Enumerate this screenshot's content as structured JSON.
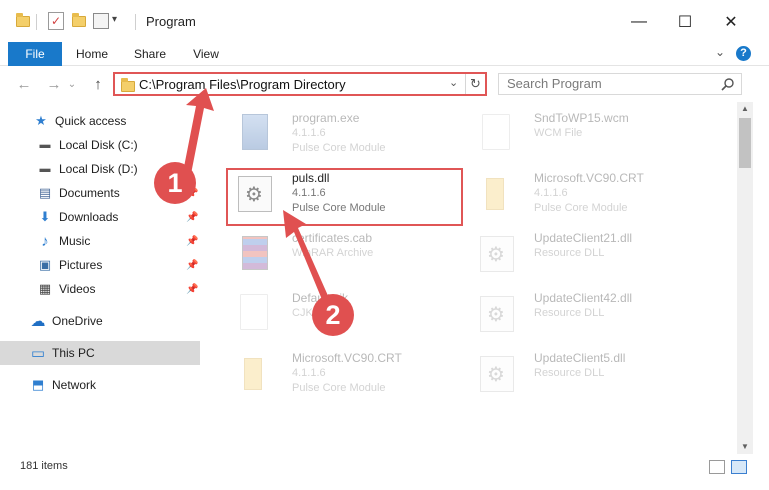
{
  "window": {
    "title": "Program",
    "minimize_glyph": "—",
    "maximize_glyph": "☐",
    "close_glyph": "✕"
  },
  "ribbon": {
    "tabs": [
      {
        "label": "File"
      },
      {
        "label": "Home"
      },
      {
        "label": "Share"
      },
      {
        "label": "View"
      }
    ],
    "help_glyph": "?",
    "collapse_glyph": "⌄"
  },
  "navigation": {
    "back_glyph": "←",
    "forward_glyph": "→",
    "recent_glyph": "⌄",
    "up_glyph": "↑"
  },
  "address": {
    "path": "C:\\Program Files\\Program Directory",
    "dropdown_glyph": "⌄",
    "refresh_glyph": "↻"
  },
  "search": {
    "placeholder": "Search Program"
  },
  "sidebar": {
    "items": [
      {
        "label": "Quick access",
        "icon": "star-icon",
        "glyph": "★",
        "color": "#2f7fd0",
        "pinned": false
      },
      {
        "label": "Local Disk (C:)",
        "icon": "drive-icon",
        "glyph": "▬",
        "color": "#555555",
        "pinned": false
      },
      {
        "label": "Local Disk (D:)",
        "icon": "drive-icon",
        "glyph": "▬",
        "color": "#555555",
        "pinned": false
      },
      {
        "label": "Documents",
        "icon": "documents-icon",
        "glyph": "▤",
        "color": "#4a6b9a",
        "pinned": true
      },
      {
        "label": "Downloads",
        "icon": "download-icon",
        "glyph": "⬇",
        "color": "#2f7fd0",
        "pinned": true
      },
      {
        "label": "Music",
        "icon": "music-icon",
        "glyph": "♪",
        "color": "#2f7fd0",
        "pinned": true
      },
      {
        "label": "Pictures",
        "icon": "pictures-icon",
        "glyph": "▣",
        "color": "#3a6ea5",
        "pinned": true
      },
      {
        "label": "Videos",
        "icon": "video-icon",
        "glyph": "▦",
        "color": "#444444",
        "pinned": true
      },
      {
        "label": "OneDrive",
        "icon": "cloud-icon",
        "glyph": "☁",
        "color": "#1f6fc4",
        "pinned": false
      },
      {
        "label": "This PC",
        "icon": "computer-icon",
        "glyph": "▭",
        "color": "#2f7fd0",
        "pinned": false,
        "selected": true
      },
      {
        "label": "Network",
        "icon": "network-icon",
        "glyph": "⬒",
        "color": "#2f7fd0",
        "pinned": false
      }
    ],
    "pin_glyph": "📌"
  },
  "files": [
    {
      "name": "program.exe",
      "line1": "4.1.1.6",
      "line2": "Pulse Core Module",
      "thumb": "exe",
      "faded": true
    },
    {
      "name": "SndToWP15.wcm",
      "line1": "WCM File",
      "line2": "",
      "thumb": "doc",
      "faded": true
    },
    {
      "name": "puls.dll",
      "line1": "4.1.1.6",
      "line2": "Pulse Core Module",
      "thumb": "gear",
      "faded": false
    },
    {
      "name": "Microsoft.VC90.CRT",
      "line1": "4.1.1.6",
      "line2": "Pulse Core Module",
      "thumb": "folder",
      "faded": true
    },
    {
      "name": "certificates.cab",
      "line1": "WinRAR Archive",
      "line2": "",
      "thumb": "rar",
      "faded": true
    },
    {
      "name": "UpdateClient21.dll",
      "line1": "Resource DLL",
      "line2": "",
      "thumb": "gear",
      "faded": true
    },
    {
      "name": "Default.cjk",
      "line1": "CJK File",
      "line2": "",
      "thumb": "doc",
      "faded": true
    },
    {
      "name": "UpdateClient42.dll",
      "line1": "Resource DLL",
      "line2": "",
      "thumb": "gear",
      "faded": true
    },
    {
      "name": "Microsoft.VC90.CRT",
      "line1": "4.1.1.6",
      "line2": "Pulse Core Module",
      "thumb": "folder",
      "faded": true
    },
    {
      "name": "UpdateClient5.dll",
      "line1": "Resource DLL",
      "line2": "",
      "thumb": "gear",
      "faded": true
    }
  ],
  "status": {
    "item_count": "181 items"
  },
  "callouts": {
    "step1": "1",
    "step2": "2"
  },
  "colors": {
    "accent": "#1979ca",
    "highlight": "#e05656",
    "callout": "#e05050"
  }
}
